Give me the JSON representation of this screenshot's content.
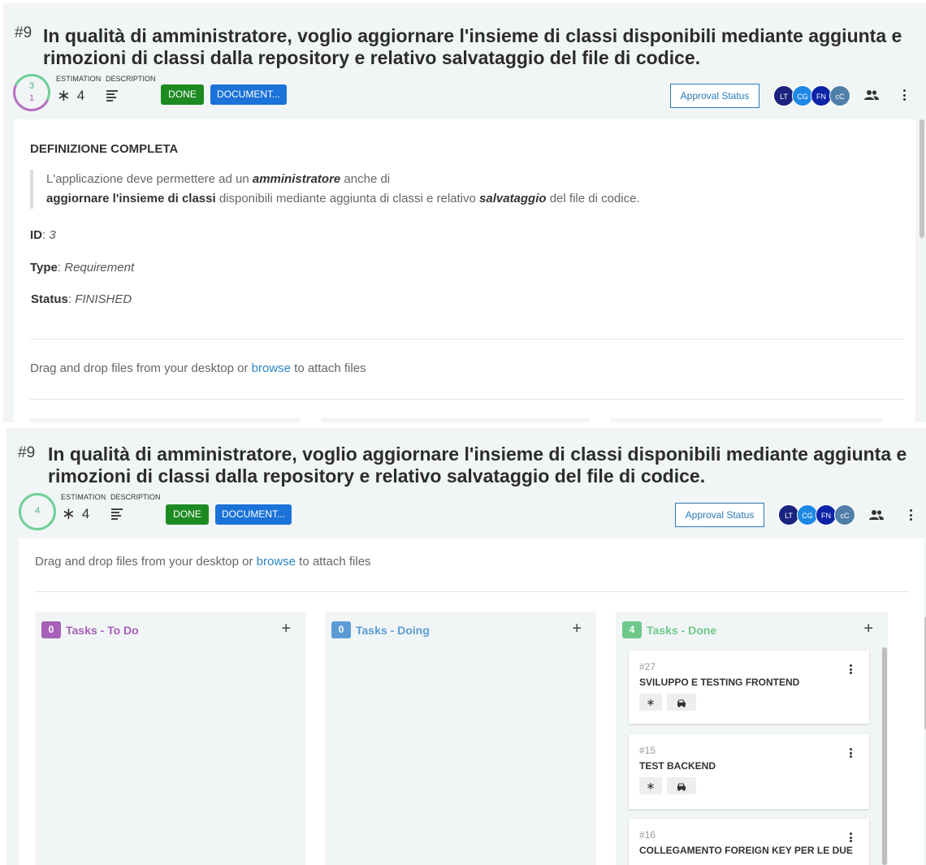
{
  "story": {
    "number": "#9",
    "title": "In qualità di amministratore, voglio aggiornare l'insieme di classi disponibili mediante aggiunta e rimozioni di classi dalla repository e relativo salvataggio del file di codice.",
    "estimation_label": "ESTIMATION",
    "description_label": "DESCRIPTION",
    "estimation_value": "4",
    "tag_status": "DONE",
    "tag_type": "DOCUMENT...",
    "approval_label": "Approval Status",
    "avatars": [
      {
        "initials": "LT",
        "color": "#1a237e"
      },
      {
        "initials": "CG",
        "color": "#1e88e5"
      },
      {
        "initials": "FN",
        "color": "#0d24a8"
      },
      {
        "initials": "cC",
        "color": "#4f7fa8"
      }
    ]
  },
  "panel1": {
    "ring_done": "3",
    "ring_todo": "1",
    "definition": {
      "title": "DEFINIZIONE COMPLETA",
      "q1": "L'applicazione deve permettere ad un ",
      "q1_em": "amministratore",
      "q1_end": " anche di",
      "q2_bold": "aggiornare l'insieme di classi",
      "q2": " disponibili mediante aggiunta di classi e relativo ",
      "q2_em": "salvataggio",
      "q2_end": " del file di codice.",
      "id_label": "ID",
      "id_value": "3",
      "type_label": "Type",
      "type_value": "Requirement",
      "status_label": "Status",
      "status_value": "FINISHED"
    }
  },
  "panel2": {
    "ring_total": "4"
  },
  "attach": {
    "before": "Drag and drop files from your desktop or ",
    "link": "browse",
    "after": " to attach files"
  },
  "columns": [
    {
      "count": "0",
      "label": "Tasks - To Do",
      "color": "#a660b8"
    },
    {
      "count": "0",
      "label": "Tasks - Doing",
      "color": "#5b9bd5"
    },
    {
      "count": "4",
      "label": "Tasks - Done",
      "color": "#6fc98b"
    }
  ],
  "tasks": [
    {
      "number": "#27",
      "title": "SVILUPPO E TESTING FRONTEND"
    },
    {
      "number": "#15",
      "title": "TEST BACKEND"
    },
    {
      "number": "#16",
      "title": "COLLEGAMENTO FOREIGN KEY PER LE DUE"
    }
  ],
  "icons": {
    "estimation": "asterisk-icon",
    "description": "description-lines-icon",
    "people": "people-icon",
    "menu": "kebab-menu-icon",
    "add": "plus-icon",
    "task_chip": "car-icon"
  }
}
